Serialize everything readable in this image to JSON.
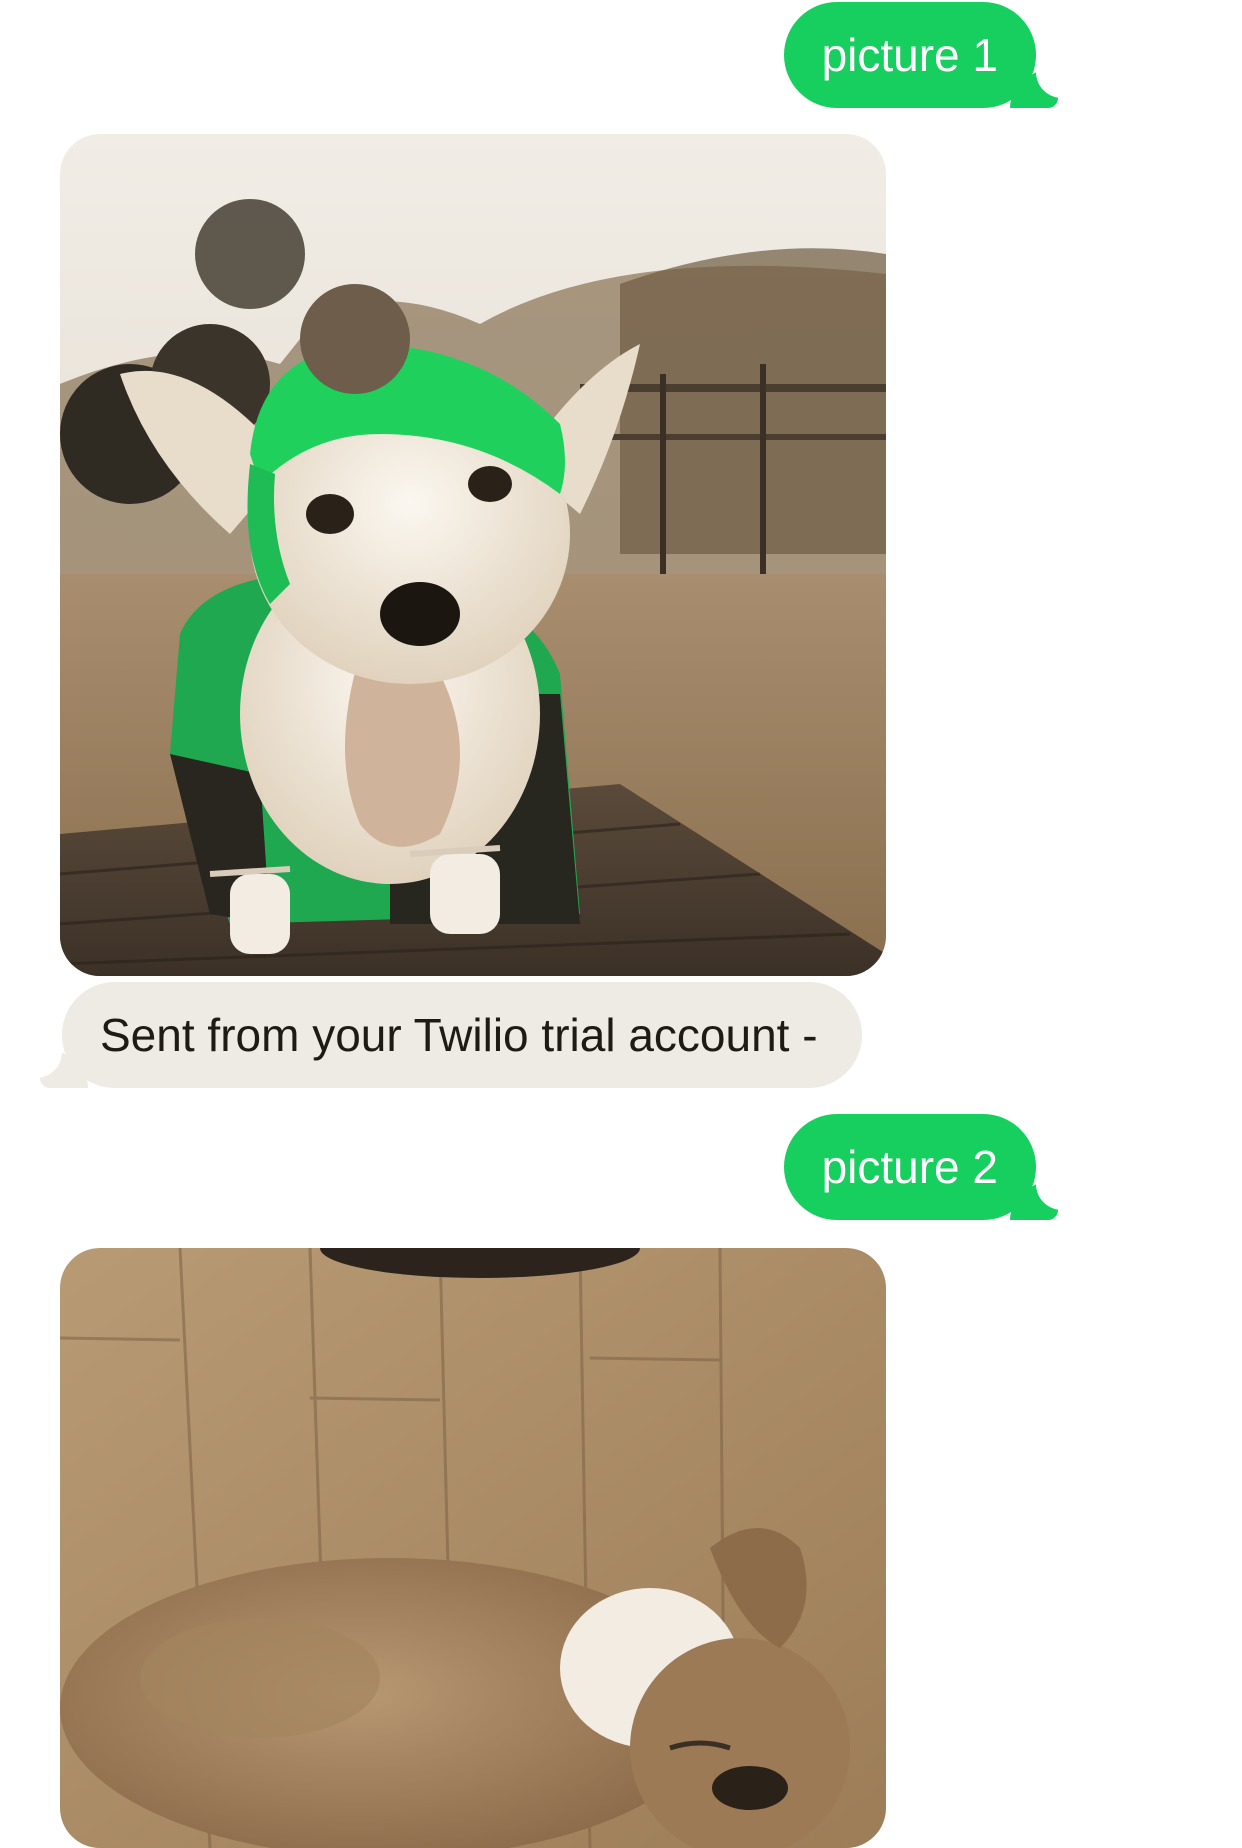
{
  "conversation": {
    "messages": [
      {
        "direction": "outgoing",
        "type": "text",
        "text": "picture 1"
      },
      {
        "direction": "incoming",
        "type": "image",
        "subject": "corgi wearing a green knit beanie and green jacket, tongue out, standing on a wooden deck"
      },
      {
        "direction": "incoming",
        "type": "text",
        "text": "Sent from your Twilio trial account -"
      },
      {
        "direction": "outgoing",
        "type": "text",
        "text": "picture 2"
      },
      {
        "direction": "incoming",
        "type": "image",
        "subject": "fluffy corgi lying asleep on a wooden floor"
      }
    ]
  },
  "colors": {
    "sent_bubble": "#17cf5e",
    "received_bubble": "#eeeae4",
    "received_text": "#1e1a14",
    "sent_text": "#ffffff",
    "background": "#ffffff"
  }
}
